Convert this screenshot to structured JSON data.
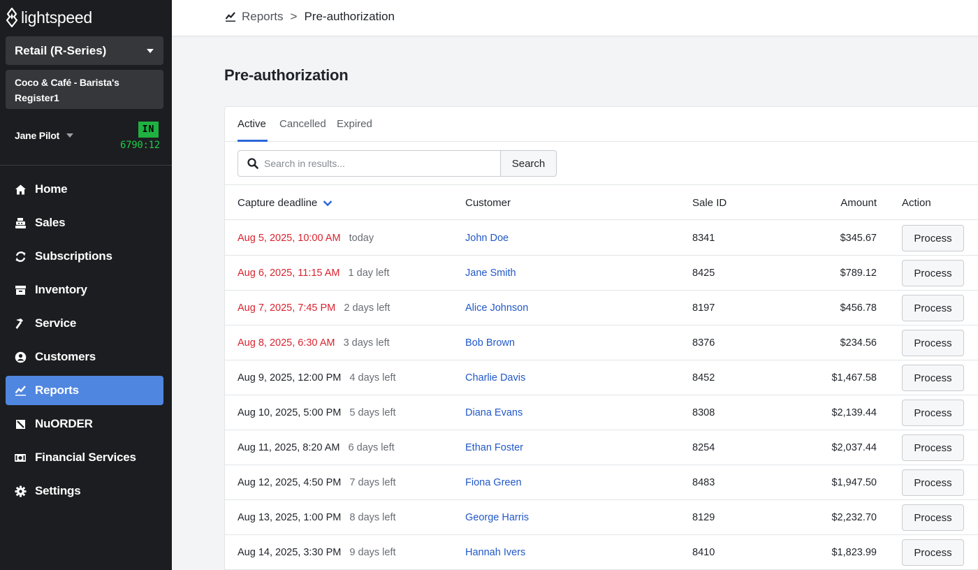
{
  "brand": {
    "name": "lightspeed"
  },
  "sidebar": {
    "product_select": "Retail (R-Series)",
    "register_line1": "Coco & Café - Barista's",
    "register_line2": "Register1",
    "user_name": "Jane Pilot",
    "clock_status": "IN",
    "clock_id": "6790:12",
    "items": [
      {
        "label": "Home",
        "icon": "home-icon"
      },
      {
        "label": "Sales",
        "icon": "register-icon"
      },
      {
        "label": "Subscriptions",
        "icon": "refresh-icon"
      },
      {
        "label": "Inventory",
        "icon": "inventory-icon"
      },
      {
        "label": "Service",
        "icon": "hammer-icon"
      },
      {
        "label": "Customers",
        "icon": "user-circle-icon"
      },
      {
        "label": "Reports",
        "icon": "chart-line-icon",
        "active": true
      },
      {
        "label": "NuORDER",
        "icon": "nuorder-icon"
      },
      {
        "label": "Financial Services",
        "icon": "money-icon"
      },
      {
        "label": "Settings",
        "icon": "gear-icon"
      }
    ]
  },
  "breadcrumb": {
    "parent": "Reports",
    "separator": ">",
    "current": "Pre-authorization"
  },
  "page": {
    "title": "Pre-authorization"
  },
  "tabs": [
    {
      "label": "Active",
      "active": true
    },
    {
      "label": "Cancelled"
    },
    {
      "label": "Expired"
    }
  ],
  "search": {
    "placeholder": "Search in results...",
    "value": "",
    "button": "Search"
  },
  "table": {
    "headers": {
      "deadline": "Capture deadline",
      "customer": "Customer",
      "sale_id": "Sale ID",
      "amount": "Amount",
      "action": "Action"
    },
    "action_label": "Process",
    "rows": [
      {
        "deadline": "Aug 5, 2025, 10:00 AM",
        "remaining": "today",
        "overdue": true,
        "customer": "John Doe",
        "sale_id": "8341",
        "amount": "$345.67"
      },
      {
        "deadline": "Aug 6, 2025, 11:15 AM",
        "remaining": "1 day left",
        "overdue": true,
        "customer": "Jane Smith",
        "sale_id": "8425",
        "amount": "$789.12"
      },
      {
        "deadline": "Aug 7, 2025, 7:45 PM",
        "remaining": "2 days left",
        "overdue": true,
        "customer": "Alice Johnson",
        "sale_id": "8197",
        "amount": "$456.78"
      },
      {
        "deadline": "Aug 8, 2025, 6:30 AM",
        "remaining": "3 days left",
        "overdue": true,
        "customer": "Bob Brown",
        "sale_id": "8376",
        "amount": "$234.56"
      },
      {
        "deadline": "Aug 9, 2025, 12:00 PM",
        "remaining": "4 days left",
        "overdue": false,
        "customer": "Charlie Davis",
        "sale_id": "8452",
        "amount": "$1,467.58"
      },
      {
        "deadline": "Aug 10, 2025, 5:00 PM",
        "remaining": "5 days left",
        "overdue": false,
        "customer": "Diana Evans",
        "sale_id": "8308",
        "amount": "$2,139.44"
      },
      {
        "deadline": "Aug 11, 2025, 8:20 AM",
        "remaining": "6 days left",
        "overdue": false,
        "customer": "Ethan Foster",
        "sale_id": "8254",
        "amount": "$2,037.44"
      },
      {
        "deadline": "Aug 12, 2025, 4:50 PM",
        "remaining": "7 days left",
        "overdue": false,
        "customer": "Fiona Green",
        "sale_id": "8483",
        "amount": "$1,947.50"
      },
      {
        "deadline": "Aug 13, 2025, 1:00 PM",
        "remaining": "8 days left",
        "overdue": false,
        "customer": "George Harris",
        "sale_id": "8129",
        "amount": "$2,232.70"
      },
      {
        "deadline": "Aug 14, 2025, 3:30 PM",
        "remaining": "9 days left",
        "overdue": false,
        "customer": "Hannah Ivers",
        "sale_id": "8410",
        "amount": "$1,823.99"
      }
    ]
  },
  "colors": {
    "accent": "#4f86e0",
    "overdue": "#d8232f",
    "link": "#2158c7",
    "clock": "#1fc94a",
    "sidebar_bg": "#1c1d20"
  }
}
